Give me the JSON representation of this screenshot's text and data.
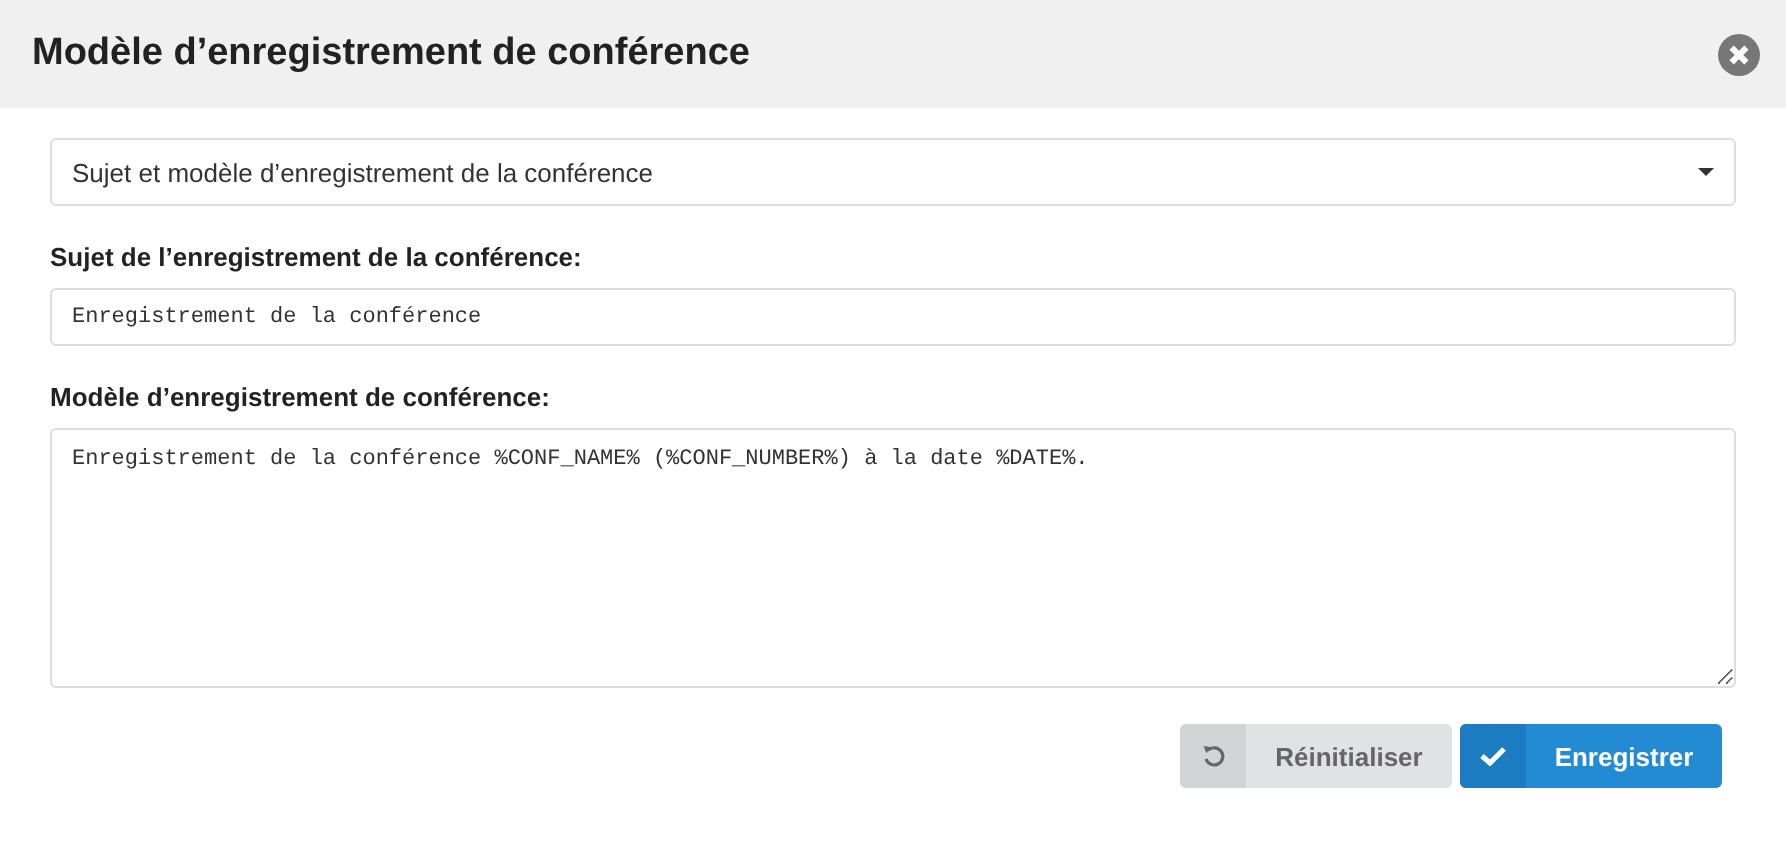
{
  "window": {
    "title": "Modèle d’enregistrement de conférence"
  },
  "select": {
    "value": "Sujet et modèle d’enregistrement de la conférence"
  },
  "fields": [
    {
      "kind": "input",
      "label": "Sujet de l’enregistrement de la conférence:",
      "value": "Enregistrement de la conférence"
    },
    {
      "kind": "textarea",
      "label": "Modèle d’enregistrement de conférence:",
      "value": "Enregistrement de la conférence %CONF_NAME% (%CONF_NUMBER%) à la date %DATE%."
    }
  ],
  "buttons": [
    {
      "kind": "reset",
      "label": "Réinitialiser"
    },
    {
      "kind": "save",
      "label": "Enregistrer"
    }
  ]
}
